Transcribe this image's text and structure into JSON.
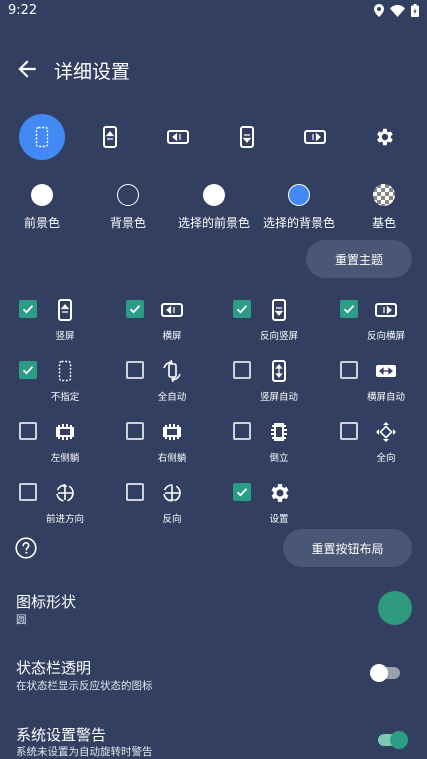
{
  "status_bar": {
    "time": "9:22"
  },
  "app_bar": {
    "title": "详细设置"
  },
  "colors": {
    "background": "#323f60",
    "accent": "#4289f4",
    "check": "#2b9c85",
    "shape": "#2f9a7f",
    "button": "#4a5676"
  },
  "orientation_tabs": [
    {
      "icon": "unspecified-icon",
      "selected": true
    },
    {
      "icon": "portrait-icon",
      "selected": false
    },
    {
      "icon": "landscape-icon",
      "selected": false
    },
    {
      "icon": "reverse-portrait-icon",
      "selected": false
    },
    {
      "icon": "reverse-landscape-icon",
      "selected": false
    },
    {
      "icon": "gear-icon",
      "selected": false
    }
  ],
  "color_choices": [
    {
      "label": "前景色",
      "color": "#ffffff"
    },
    {
      "label": "背景色",
      "color": "#323f60"
    },
    {
      "label": "选择的前景色",
      "color": "#ffffff"
    },
    {
      "label": "选择的背景色",
      "color": "#4289f4"
    },
    {
      "label": "基色",
      "color": "checker"
    }
  ],
  "reset_theme": "重置主题",
  "buttons_grid": [
    {
      "label": "竖屏",
      "checked": true,
      "icon": "portrait-icon"
    },
    {
      "label": "横屏",
      "checked": true,
      "icon": "landscape-icon"
    },
    {
      "label": "反向竖屏",
      "checked": true,
      "icon": "reverse-portrait-icon"
    },
    {
      "label": "反向横屏",
      "checked": true,
      "icon": "reverse-landscape-icon"
    },
    {
      "label": "不指定",
      "checked": true,
      "icon": "unspecified-icon"
    },
    {
      "label": "全自动",
      "checked": false,
      "icon": "auto-rotate-icon"
    },
    {
      "label": "竖屏自动",
      "checked": false,
      "icon": "portrait-auto-icon"
    },
    {
      "label": "横屏自动",
      "checked": false,
      "icon": "landscape-auto-icon"
    },
    {
      "label": "左侧躺",
      "checked": false,
      "icon": "lie-left-icon"
    },
    {
      "label": "右侧躺",
      "checked": false,
      "icon": "lie-right-icon"
    },
    {
      "label": "倒立",
      "checked": false,
      "icon": "headstand-icon"
    },
    {
      "label": "全向",
      "checked": false,
      "icon": "omni-icon"
    },
    {
      "label": "前进方向",
      "checked": false,
      "icon": "forward-direction-icon"
    },
    {
      "label": "反向",
      "checked": false,
      "icon": "reverse-icon"
    },
    {
      "label": "设置",
      "checked": true,
      "icon": "gear-icon"
    }
  ],
  "reset_layout": "重置按钮布局",
  "prefs": {
    "icon_shape": {
      "title": "图标形状",
      "sub": "圆"
    },
    "status_transparent": {
      "title": "状态栏透明",
      "sub": "在状态栏显示反应状态的图标",
      "on": false
    },
    "system_warning": {
      "title": "系统设置警告",
      "sub": "系统未设置为自动旋转时警告",
      "on": true
    }
  }
}
